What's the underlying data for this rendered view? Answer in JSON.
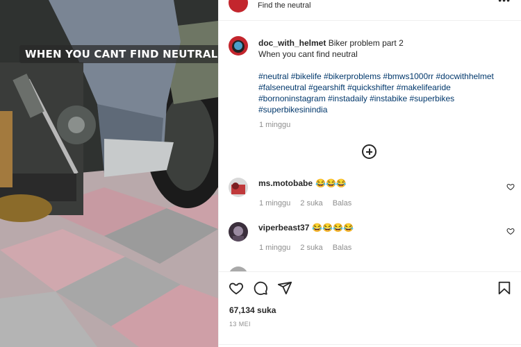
{
  "media": {
    "overlay_text": "WHEN YOU CANT FIND NEUTRAL",
    "overlay_emoji": "😂"
  },
  "header": {
    "subtitle": "Find the neutral",
    "more_icon": "ellipsis-icon"
  },
  "post": {
    "username": "doc_with_helmet",
    "caption_line1": "Biker problem part 2",
    "caption_line2": "When you cant find neutral",
    "hashtags": "#neutral #bikelife #bikerproblems #bmws1000rr #docwithhelmet #falseneutral #gearshift #quickshifter #makelifearide #bornoninstagram #instadaily #instabike #superbikes #superbikesinindia",
    "time": "1 minggu"
  },
  "comments": [
    {
      "username": "ms.motobabe",
      "emoji": "😂😂😂",
      "time": "1 minggu",
      "likes": "2 suka",
      "reply": "Balas"
    },
    {
      "username": "viperbeast37",
      "emoji": "😂😂😂😂",
      "time": "1 minggu",
      "likes": "2 suka",
      "reply": "Balas"
    }
  ],
  "footer": {
    "likes": "67,134 suka",
    "date": "13 MEI"
  },
  "colors": {
    "text": "#262626",
    "muted": "#8e8e8e",
    "hashtag": "#00376b",
    "divider": "#efefef"
  }
}
